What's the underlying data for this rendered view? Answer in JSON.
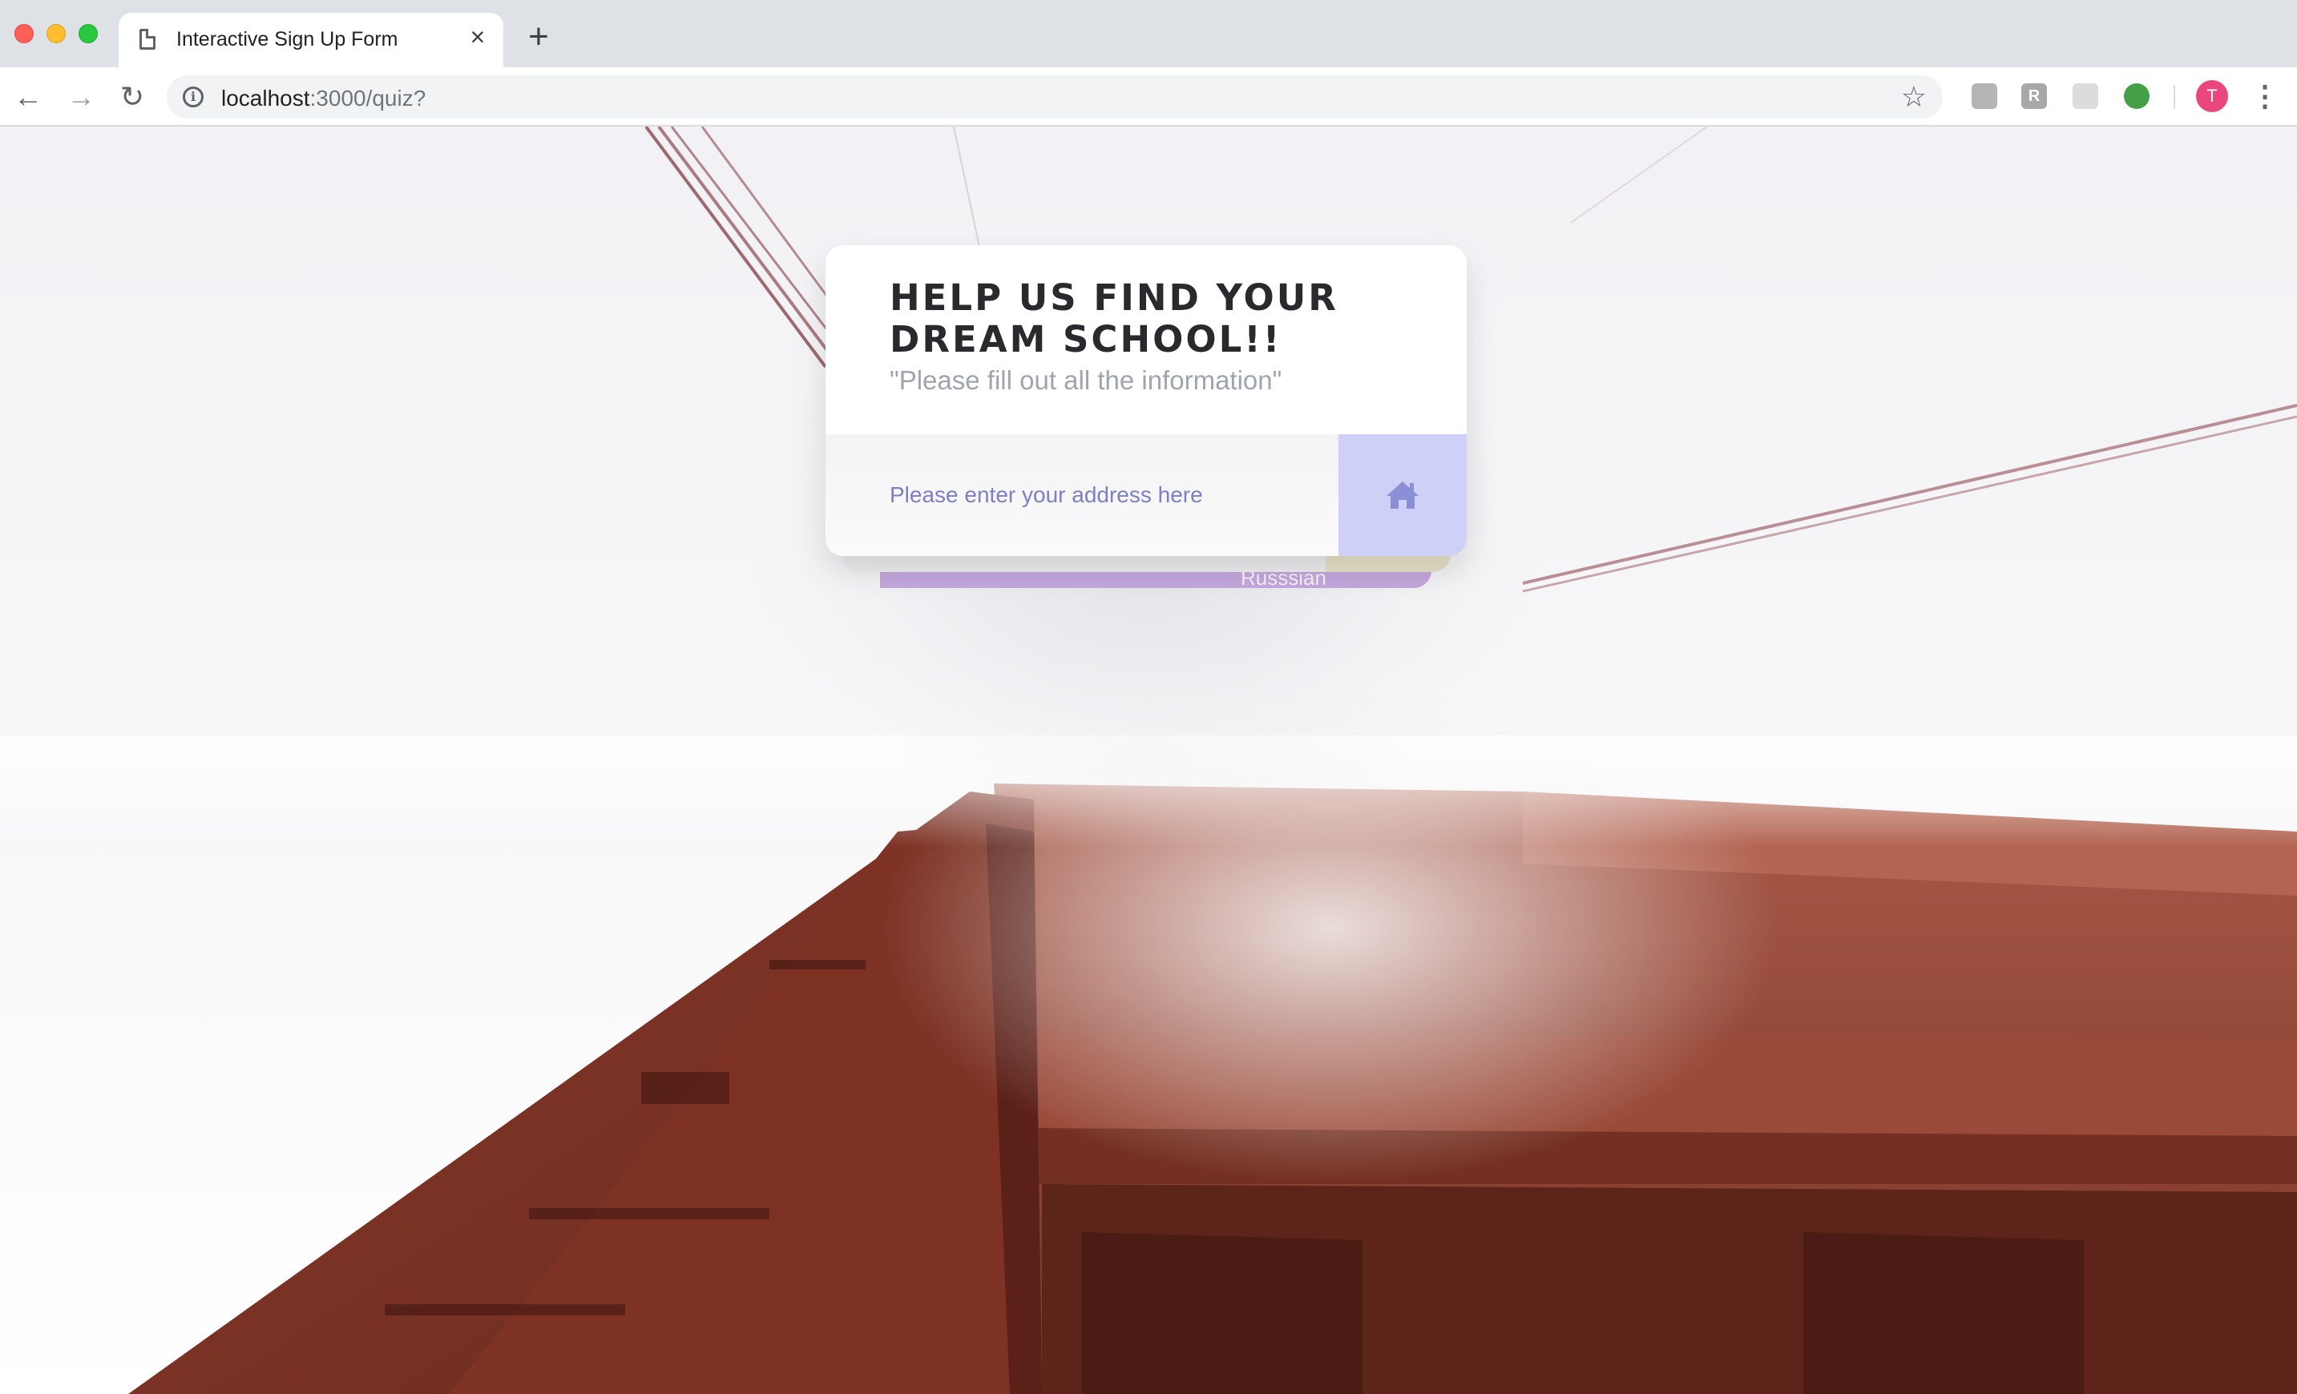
{
  "browser": {
    "tab_title": "Interactive Sign Up Form",
    "tab_close": "×",
    "new_tab": "+",
    "url_host": "localhost",
    "url_path": ":3000/quiz?",
    "avatar_initial": "T",
    "menu_glyph": "⋮",
    "star_glyph": "☆",
    "back_glyph": "←",
    "forward_glyph": "→",
    "reload_glyph": "↻"
  },
  "form": {
    "title": "HELP US FIND YOUR DREAM SCHOOL!!",
    "subtitle": "\"Please fill out all the information\"",
    "address_placeholder": "Please enter your address here",
    "home_icon": "home-icon",
    "stack_label": "Russsian"
  },
  "colors": {
    "accent": "#cfd0f8",
    "input_text": "#7e7ec4",
    "stack_purple": "#c3a8dc",
    "stack_yellow": "#e6e2c8"
  }
}
